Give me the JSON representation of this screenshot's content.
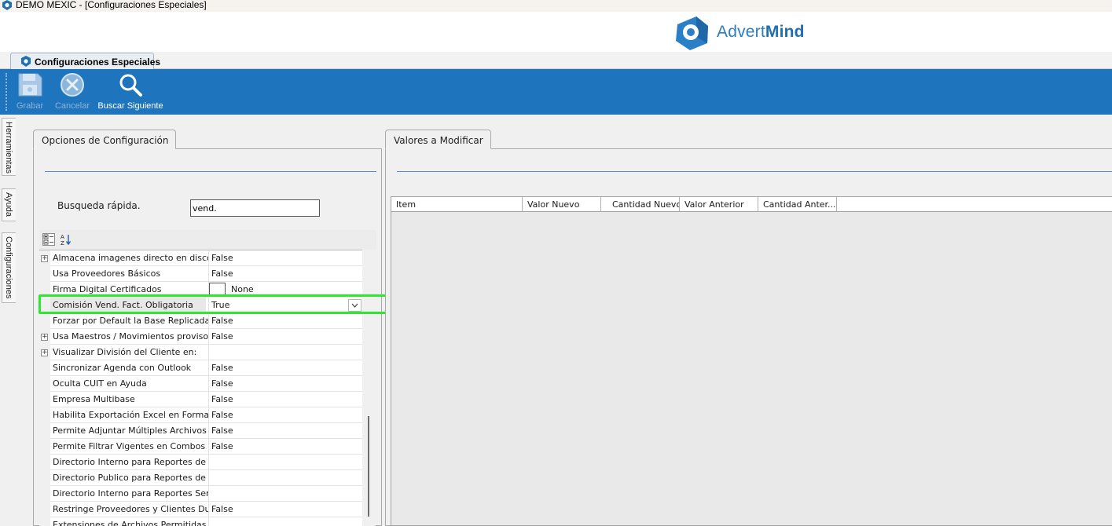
{
  "window": {
    "title": "DEMO MEXIC - [Configuraciones Especiales]"
  },
  "logo": {
    "brand_regular": "Advert",
    "brand_bold": "Mind"
  },
  "doc_tab": {
    "label": "Configuraciones Especiales"
  },
  "toolbar": {
    "save_label": "Grabar",
    "cancel_label": "Cancelar",
    "find_next_label": "Buscar Siguiente"
  },
  "side_tabs": [
    "Herramientas",
    "Ayuda",
    "Configuraciones"
  ],
  "left_panel": {
    "title": "Opciones de Configuración",
    "search_label": "Busqueda rápida.",
    "search_value": "vend."
  },
  "property_grid": {
    "rows": [
      {
        "name": "Almacena imagenes directo en disco",
        "value": "False",
        "expandable": true
      },
      {
        "name": "Usa Proveedores Básicos",
        "value": "False"
      },
      {
        "name": "Firma Digital Certificados",
        "value": "None",
        "swatch": true
      },
      {
        "name": "Comisión Vend. Fact. Obligatoria",
        "value": "True",
        "selected": true
      },
      {
        "name": "Forzar por Default la Base Replicada",
        "value": "False"
      },
      {
        "name": "Usa Maestros / Movimientos provisorios",
        "value": "False",
        "expandable": true
      },
      {
        "name": "Visualizar División del Cliente en:",
        "value": "",
        "expandable": true
      },
      {
        "name": "Sincronizar Agenda con Outlook",
        "value": "False"
      },
      {
        "name": "Oculta CUIT en Ayuda",
        "value": "False"
      },
      {
        "name": "Empresa Multibase",
        "value": "False"
      },
      {
        "name": "Habilita Exportación Excel en Formato Nativo",
        "value": "False"
      },
      {
        "name": "Permite Adjuntar Múltiples Archivos",
        "value": "False"
      },
      {
        "name": "Permite Filtrar Vigentes en Combos",
        "value": "False"
      },
      {
        "name": "Directorio Interno para Reportes de Servicio",
        "value": ""
      },
      {
        "name": "Directorio Publico para Reportes de Servicio",
        "value": ""
      },
      {
        "name": "Directorio Interno para Reportes Servicio",
        "value": ""
      },
      {
        "name": "Restringe Proveedores y Clientes Duplicados",
        "value": "False"
      },
      {
        "name": "Extensiones de Archivos Permitidas",
        "value": ""
      }
    ]
  },
  "right_panel": {
    "title": "Valores a Modificar",
    "columns": [
      "Item",
      "Valor Nuevo",
      "Cantidad Nuevo",
      "Valor Anterior",
      "Cantidad Anter..."
    ]
  },
  "colors": {
    "toolbar_bg": "#1f75bd",
    "highlight": "#2ee82e",
    "brand": "#2d7dbf"
  },
  "icons": {
    "app": "app-logo-icon",
    "save": "floppy-disk-icon",
    "cancel": "cancel-circle-icon",
    "find": "magnifier-icon",
    "categorized": "categorized-view-icon",
    "alphabetical": "sort-az-icon",
    "dropdown": "chevron-down-icon",
    "expand": "plus-box-icon"
  }
}
